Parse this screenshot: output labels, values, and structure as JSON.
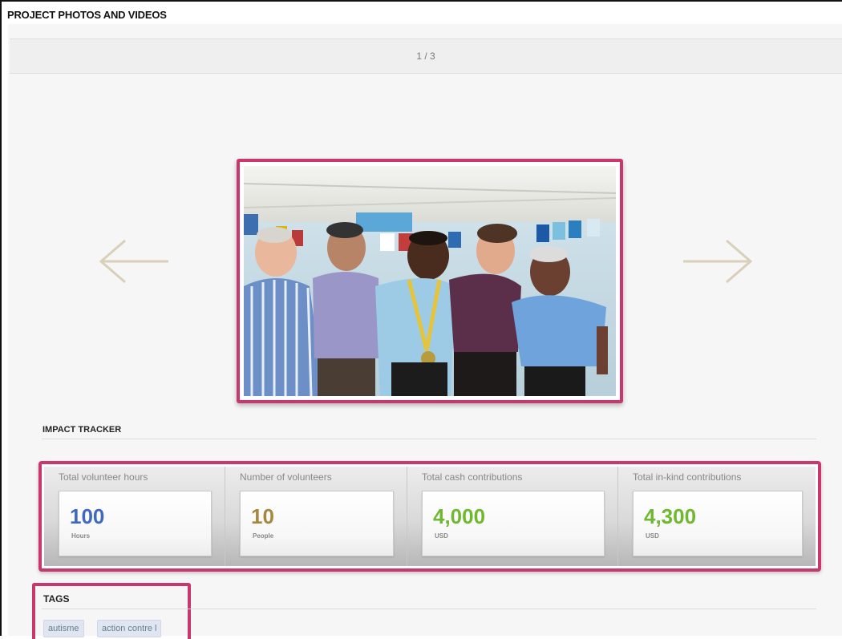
{
  "gallery": {
    "title": "PROJECT PHOTOS AND VIDEOS",
    "counter": "1 / 3",
    "prev_icon": "arrow-left-icon",
    "next_icon": "arrow-right-icon"
  },
  "impact": {
    "title": "IMPACT TRACKER",
    "stats": [
      {
        "label": "Total volunteer hours",
        "value": "100",
        "unit": "Hours",
        "color": "#3f68c2"
      },
      {
        "label": "Number of volunteers",
        "value": "10",
        "unit": "People",
        "color": "#a88640"
      },
      {
        "label": "Total cash contributions",
        "value": "4,000",
        "unit": "USD",
        "color": "#6fb82f"
      },
      {
        "label": "Total in-kind contributions",
        "value": "4,300",
        "unit": "USD",
        "color": "#6fb82f"
      }
    ]
  },
  "tags": {
    "title": "TAGS",
    "items": [
      "autisme",
      "action contre l"
    ]
  },
  "colors": {
    "highlight": "#c8386c"
  }
}
